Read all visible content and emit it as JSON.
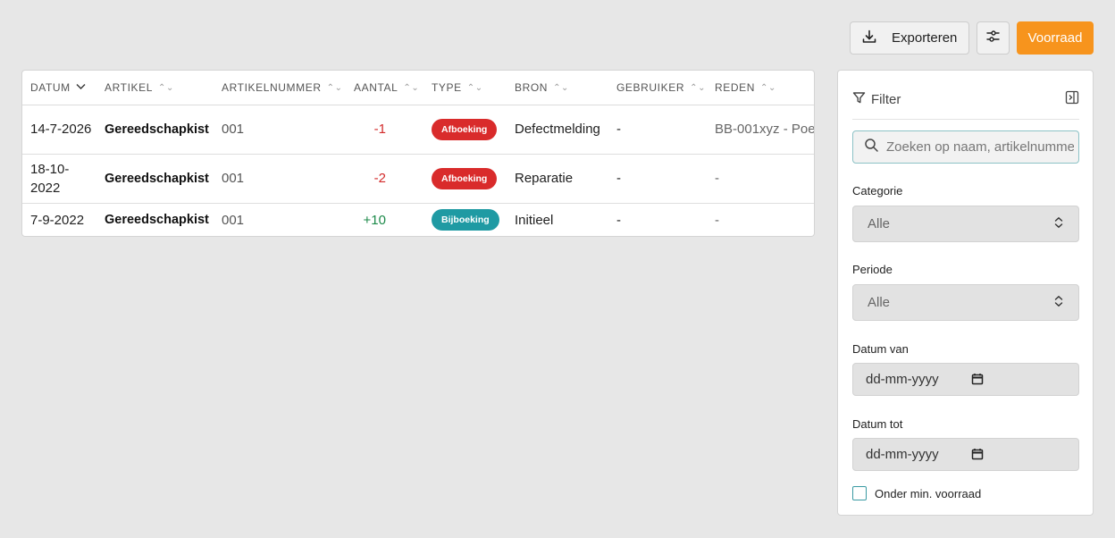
{
  "toolbar": {
    "export_label": "Exporteren",
    "stock_label": "Voorraad",
    "accent_color": "#f7941d"
  },
  "table": {
    "columns": [
      "DATUM",
      "ARTIKEL",
      "ARTIKELNUMMER",
      "AANTAL",
      "TYPE",
      "BRON",
      "GEBRUIKER",
      "REDEN"
    ],
    "sorted_column": "DATUM",
    "rows": [
      {
        "datum": "14-7-2026",
        "artikel": "Gereedschapkist",
        "artikelnummer": "001",
        "aantal": "-1",
        "type": "Afboeking",
        "bron": "Defectmelding",
        "gebruiker": "-",
        "reden": "BB-001xyz - Poe"
      },
      {
        "datum": "18-10-2022",
        "artikel": "Gereedschapkist",
        "artikelnummer": "001",
        "aantal": "-2",
        "type": "Afboeking",
        "bron": "Reparatie",
        "gebruiker": "-",
        "reden": "-"
      },
      {
        "datum": "7-9-2022",
        "artikel": "Gereedschapkist",
        "artikelnummer": "001",
        "aantal": "+10",
        "type": "Bijboeking",
        "bron": "Initieel",
        "gebruiker": "-",
        "reden": "-"
      }
    ]
  },
  "filter": {
    "title": "Filter",
    "search_placeholder": "Zoeken op naam, artikelnummer",
    "categorie_label": "Categorie",
    "categorie_value": "Alle",
    "periode_label": "Periode",
    "periode_value": "Alle",
    "datum_van_label": "Datum van",
    "datum_van_value": "dd-mm-yyyy",
    "datum_tot_label": "Datum tot",
    "datum_tot_value": "dd-mm-yyyy",
    "min_stock_label": "Onder min. voorraad",
    "min_stock_checked": false
  },
  "icons": {
    "export": "download-icon",
    "settings": "sliders-icon",
    "filter": "filter-icon",
    "collapse": "panel-collapse-icon",
    "search": "search-icon",
    "select": "chevron-updown-icon",
    "calendar": "calendar-icon"
  }
}
